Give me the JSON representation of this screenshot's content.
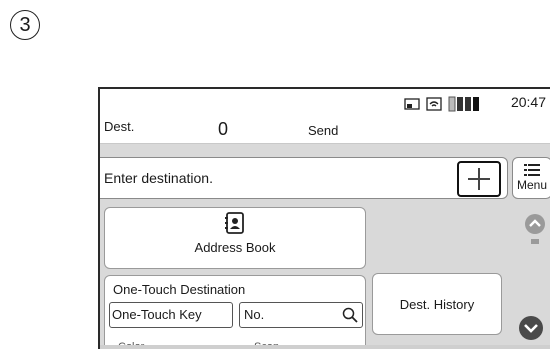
{
  "step_number": "3",
  "status": {
    "time": "20:47",
    "icons": [
      "sd-card-icon",
      "wifi-icon",
      "toner-level-icon"
    ]
  },
  "info": {
    "dest_label": "Dest.",
    "dest_count": "0",
    "mode": "Send"
  },
  "destination": {
    "placeholder": "Enter destination.",
    "add_icon": "plus-icon",
    "menu_label": "Menu",
    "menu_icon": "list-icon"
  },
  "address_book": {
    "label": "Address Book",
    "icon": "address-book-icon"
  },
  "one_touch": {
    "title": "One-Touch Destination",
    "key_field": "One-Touch Key",
    "no_field": "No.",
    "search_icon": "search-icon",
    "partial_labels": [
      "Color",
      "Scan"
    ]
  },
  "history": {
    "label": "Dest. History"
  },
  "scroll": {
    "up_icon": "chevron-up-icon",
    "down_icon": "chevron-down-icon"
  },
  "colors": {
    "screen_bg": "#d9d9d9",
    "panel_bg": "#ffffff",
    "outline": "#111111"
  }
}
